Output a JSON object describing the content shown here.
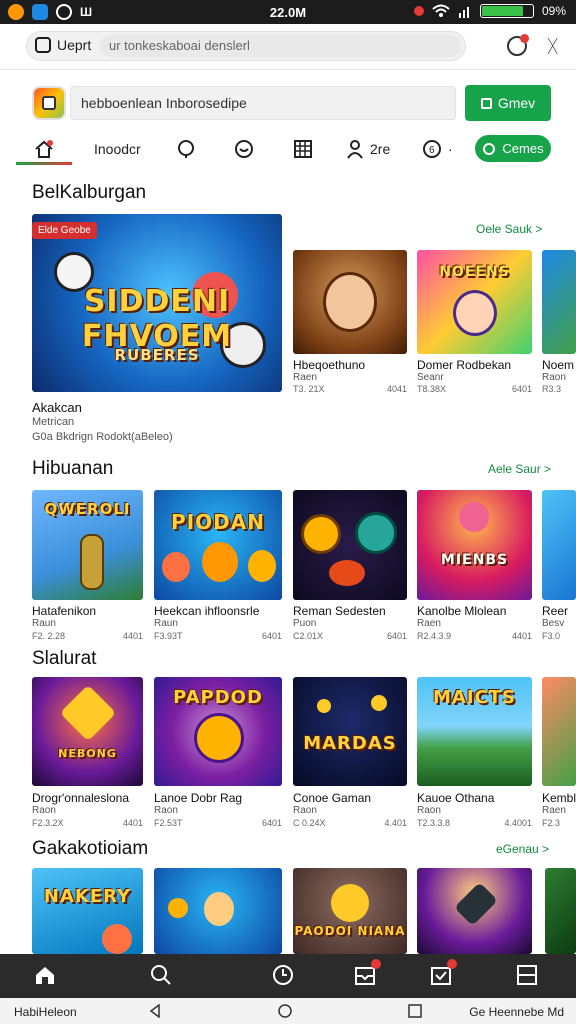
{
  "status": {
    "time": "22.0M",
    "battery": "09%",
    "battery_level": 0.78
  },
  "browser": {
    "tab_label": "Ueprt",
    "url": "ur tonkeskaboai denslerl"
  },
  "header": {
    "search_text": "hebboenlean  Inborosedipe",
    "search_button": "Gmev"
  },
  "nav": {
    "tabs": [
      {
        "label": "",
        "icon": "home-icon"
      },
      {
        "label": "Inoodcr",
        "icon": ""
      },
      {
        "label": "",
        "icon": "chat-bubble-icon"
      },
      {
        "label": "",
        "icon": "refresh-chat-icon"
      },
      {
        "label": "",
        "icon": "grid-icon"
      },
      {
        "label": "2re",
        "icon": "user-icon"
      },
      {
        "label": "·",
        "icon": "coin-icon"
      }
    ],
    "cta_label": "Cemes"
  },
  "sections": [
    {
      "title": "BelKalburgan",
      "see_all": "Oele Sauk >"
    },
    {
      "title": "Hibuanan",
      "see_all": "Aele Saur >"
    },
    {
      "title": "Slalurat",
      "see_all": ""
    },
    {
      "title": "Gakakotioiam",
      "see_all": "eGenau >"
    }
  ],
  "featured": {
    "badge": "Elde Geobe",
    "art_title": "SIDDENI FHVOEM",
    "art_sub": "RUBERES",
    "title": "Akakcan",
    "sub": "Metrican",
    "meta": "G0a Bkdrign  Rodokt(aBeleo)"
  },
  "row1": [
    {
      "title": "Hbeqoethuno",
      "sub": "Raen",
      "left": "T3. 21X",
      "right": "4041"
    },
    {
      "title": "Domer Rodbekan",
      "sub": "Seanr",
      "left": "T8.38X",
      "right": "6401"
    },
    {
      "title": "Noem",
      "sub": "Raon",
      "left": "R3.3",
      "right": ""
    }
  ],
  "row2": [
    {
      "title": "Hatafenikon",
      "sub": "Raun",
      "left": "F2. 2.28",
      "right": "4401",
      "art": "QWEROLI"
    },
    {
      "title": "Heekcan ihfloonsrle",
      "sub": "Raun",
      "left": "F3.93T",
      "right": "6401",
      "art": "PIODAN"
    },
    {
      "title": "Reman Sedesten",
      "sub": "Puon",
      "left": "C2.01X",
      "right": "6401",
      "art": ""
    },
    {
      "title": "Kanolbe Mlolean",
      "sub": "Raen",
      "left": "R2.4.3.9",
      "right": "4401",
      "art": "MIENBS"
    },
    {
      "title": "Reer",
      "sub": "Besv",
      "left": "F3.0",
      "right": "",
      "art": ""
    }
  ],
  "row3": [
    {
      "title": "Drogr'onnaleslona",
      "sub": "Raon",
      "left": "F2.3.2X",
      "right": "4401",
      "art": "NEBONG"
    },
    {
      "title": "Lanoe Dobr Rag",
      "sub": "Raon",
      "left": "F2.53T",
      "right": "6401",
      "art": "PAPDOD"
    },
    {
      "title": "Conoe Gaman",
      "sub": "Raon",
      "left": "C 0.24X",
      "right": "4.401",
      "art": "MARDAS"
    },
    {
      "title": "Kauoe Othana",
      "sub": "Raon",
      "left": "T2.3.3.8",
      "right": "4.4001",
      "art": "MAICTS"
    },
    {
      "title": "Kembl",
      "sub": "Raen",
      "left": "F2.3",
      "right": "",
      "art": ""
    }
  ],
  "row4": [
    {
      "art": "NAKERY"
    },
    {
      "art": ""
    },
    {
      "art": "PAODOI NIANA"
    },
    {
      "art": ""
    },
    {
      "art": ""
    }
  ],
  "system": {
    "left_label": "HabiHeleon",
    "right_label": "Ge Heennebe Md"
  }
}
